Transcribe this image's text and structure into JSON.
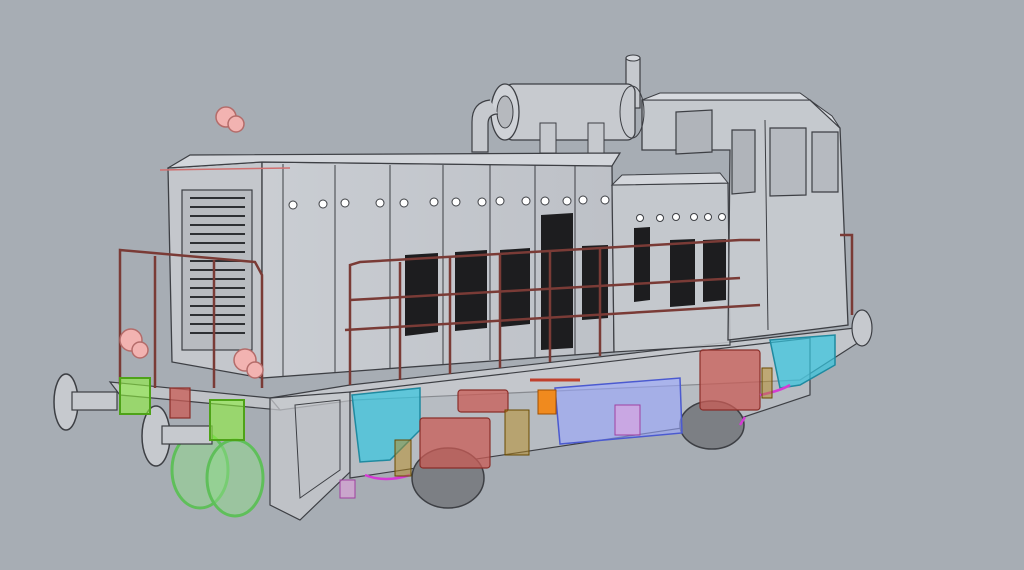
{
  "viewport": {
    "background_color": "#a7adb4",
    "view": "perspective",
    "display_mode": "ghosted",
    "subject": "diesel-shunter-locomotive-model"
  },
  "colors": {
    "body_outline": "#3d3f44",
    "body_fill": "#c9ccd1",
    "handrail": "#7a3b36",
    "vent_grille": "#1b1b1b",
    "wheel_highlight": "#7ed67a",
    "buffer_green": "#8ff23f",
    "sandbox_cyan": "#34c6e0",
    "lamp_pink": "#f0a8a8",
    "spring_red": "#c95c56",
    "fuel_tank_blue": "#9aa6ff",
    "pipe_magenta": "#d43bd4",
    "orange_part": "#f08a1e"
  }
}
